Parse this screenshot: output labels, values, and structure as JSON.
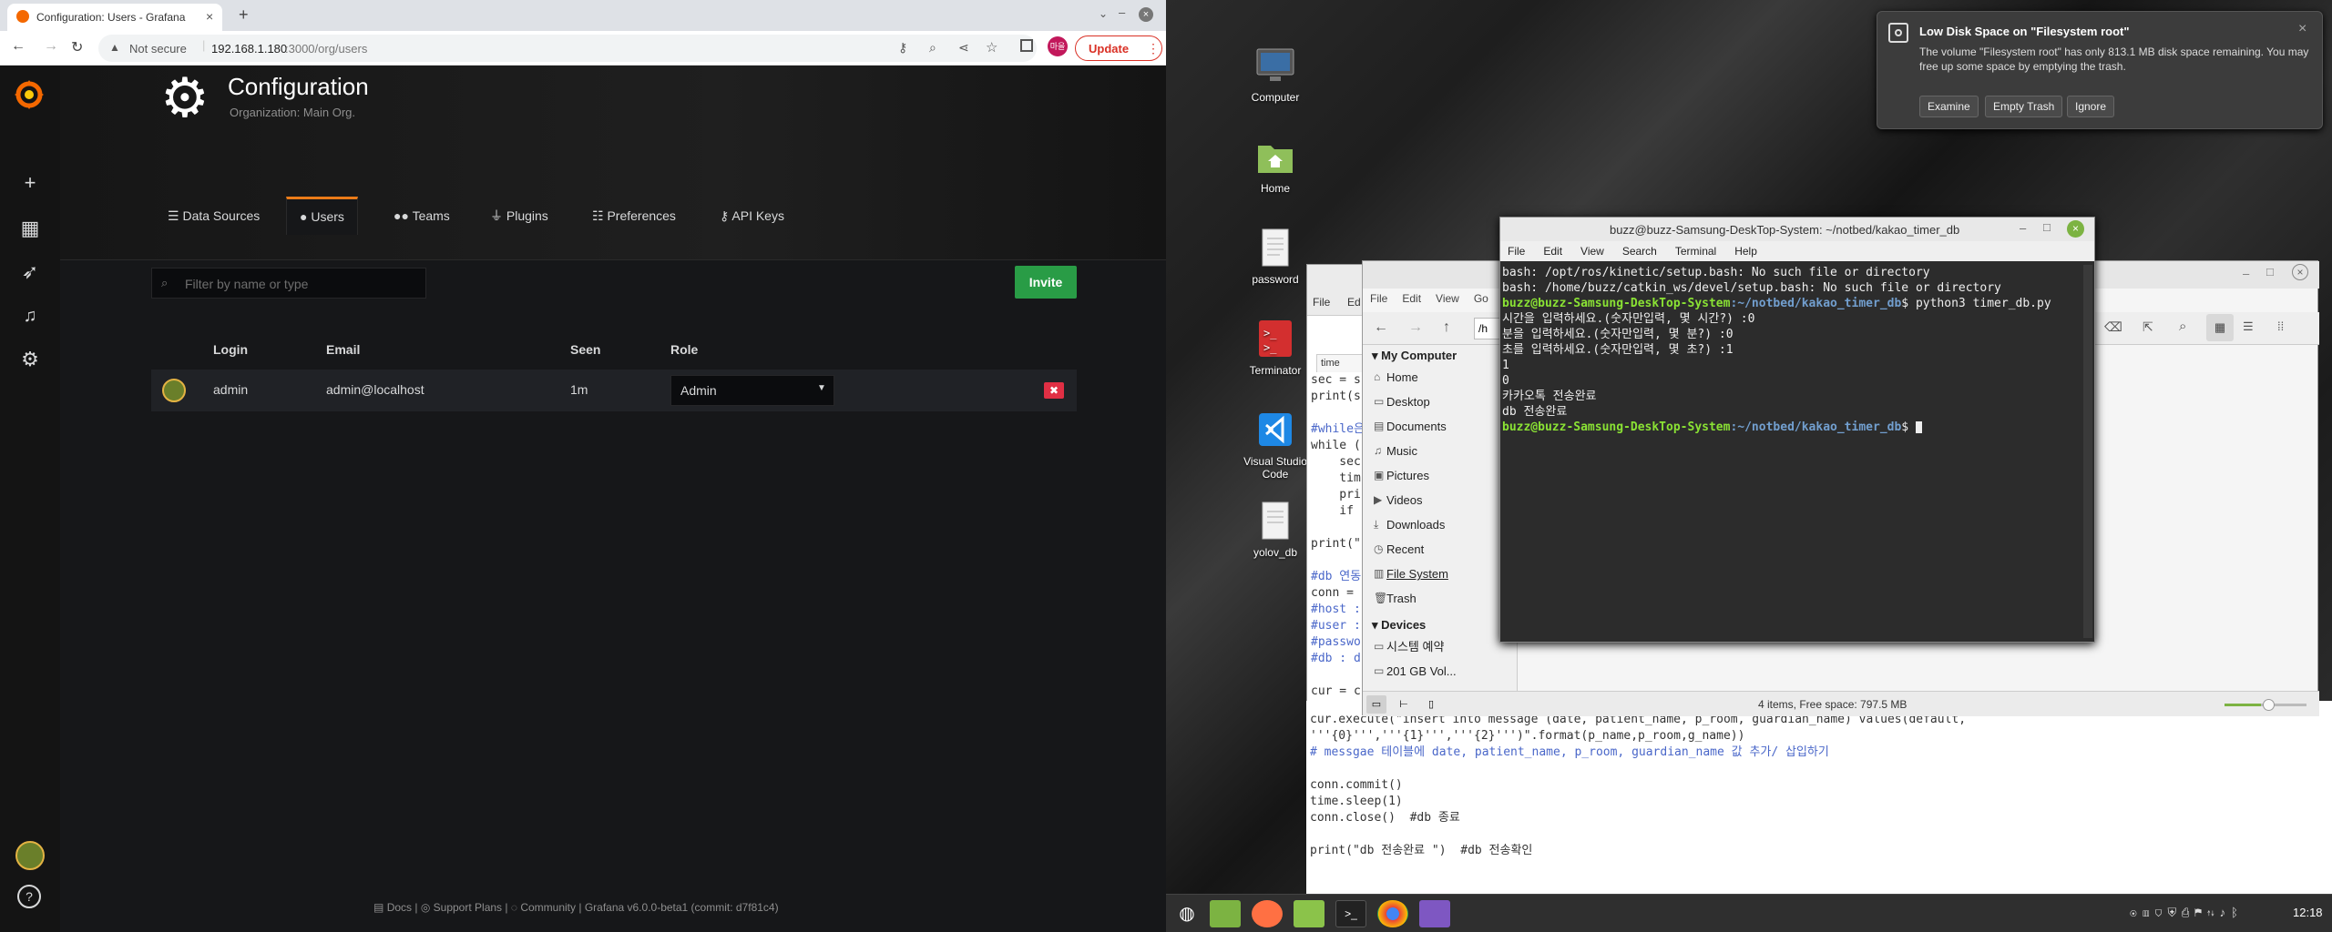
{
  "browser": {
    "tab_title": "Configuration: Users - Grafana",
    "new_tab": "+",
    "not_secure": "Not secure",
    "url_host": "192.168.1.180",
    "url_path": ":3000/org/users",
    "update_label": "Update",
    "profile_text": "마을"
  },
  "grafana": {
    "page_title": "Configuration",
    "page_subtitle": "Organization: Main Org.",
    "tabs": [
      {
        "label": "Data Sources",
        "icon": "database-icon"
      },
      {
        "label": "Users",
        "icon": "user-icon"
      },
      {
        "label": "Teams",
        "icon": "users-icon"
      },
      {
        "label": "Plugins",
        "icon": "plug-icon"
      },
      {
        "label": "Preferences",
        "icon": "sliders-icon"
      },
      {
        "label": "API Keys",
        "icon": "key-icon"
      }
    ],
    "filter_placeholder": "Filter by name or type",
    "invite_label": "Invite",
    "table": {
      "headers": [
        "Login",
        "Email",
        "Seen",
        "Role"
      ],
      "rows": [
        {
          "login": "admin",
          "email": "admin@localhost",
          "seen": "1m",
          "role": "Admin"
        }
      ]
    },
    "footer": {
      "docs": "Docs",
      "support": "Support Plans",
      "community": "Community",
      "version": "Grafana v6.0.0-beta1 (commit: d7f81c4)"
    }
  },
  "desktop": {
    "icons": [
      "Computer",
      "Home",
      "password",
      "Terminator",
      "Visual Studio Code",
      "yolov_db"
    ]
  },
  "notification": {
    "title": "Low Disk Space on \"Filesystem root\"",
    "body": "The volume \"Filesystem root\" has only 813.1 MB disk space remaining.  You may free up some space by emptying the trash.",
    "buttons": [
      "Examine",
      "Empty Trash",
      "Ignore"
    ]
  },
  "terminal": {
    "title": "buzz@buzz-Samsung-DeskTop-System: ~/notbed/kakao_timer_db",
    "menu": [
      "File",
      "Edit",
      "View",
      "Search",
      "Terminal",
      "Help"
    ],
    "lines": [
      {
        "text": "bash: /opt/ros/kinetic/setup.bash: No such file or directory",
        "kind": "plain"
      },
      {
        "text": "bash: /home/buzz/catkin_ws/devel/setup.bash: No such file or directory",
        "kind": "plain"
      },
      {
        "prompt_user": "buzz@buzz-Samsung-DeskTop-System",
        "prompt_path": ":~/notbed/kakao_timer_db",
        "cmd": "$ python3 timer_db.py",
        "kind": "prompt"
      },
      {
        "text": "시간을 입력하세요.(숫자만입력, 몇 시간?) :0",
        "kind": "plain"
      },
      {
        "text": "분을 입력하세요.(숫자만입력, 몇 분?) :0",
        "kind": "plain"
      },
      {
        "text": "초를 입력하세요.(숫자만입력, 몇 초?) :1",
        "kind": "plain"
      },
      {
        "text": "1",
        "kind": "plain"
      },
      {
        "text": "0",
        "kind": "plain"
      },
      {
        "text": "카카오톡 전송완료",
        "kind": "plain"
      },
      {
        "text": "db 전송완료",
        "kind": "plain"
      },
      {
        "prompt_user": "buzz@buzz-Samsung-DeskTop-System",
        "prompt_path": ":~/notbed/kakao_timer_db",
        "cmd": "$ ",
        "kind": "prompt"
      }
    ]
  },
  "file_manager": {
    "menu": [
      "File",
      "Edit",
      "View",
      "Go"
    ],
    "path_fragment": "/h",
    "section_my_computer": "My Computer",
    "places": [
      "Home",
      "Desktop",
      "Documents",
      "Music",
      "Pictures",
      "Videos",
      "Downloads",
      "Recent",
      "File System",
      "Trash"
    ],
    "section_devices": "Devices",
    "devices": [
      "시스템 예약",
      "201 GB Vol..."
    ],
    "status": "4 items, Free space: 797.5 MB"
  },
  "editor": {
    "menu_fragment": "File",
    "menu_fragment2": "Ed",
    "tab_fragment": "time",
    "code_top": [
      {
        "text": "sec = s",
        "color": "#333"
      },
      {
        "text": "print(s",
        "color": "#333"
      },
      {
        "text": "",
        "color": "#333"
      },
      {
        "text": "#while은",
        "color": "#4a67c9"
      },
      {
        "text": "while (",
        "color": "#333"
      },
      {
        "text": "    sec",
        "color": "#333"
      },
      {
        "text": "    tim",
        "color": "#333"
      },
      {
        "text": "    pri",
        "color": "#333"
      },
      {
        "text": "    if",
        "color": "#333"
      },
      {
        "text": "",
        "color": "#333"
      },
      {
        "text": "print(\"",
        "color": "#333"
      },
      {
        "text": "",
        "color": "#333"
      },
      {
        "text": "#db 연동",
        "color": "#4a67c9"
      },
      {
        "text": "conn =",
        "color": "#333"
      },
      {
        "text": "#host :",
        "color": "#4a67c9"
      },
      {
        "text": "#user :",
        "color": "#4a67c9"
      },
      {
        "text": "#passwo",
        "color": "#4a67c9"
      },
      {
        "text": "#db : d",
        "color": "#4a67c9"
      },
      {
        "text": "",
        "color": "#333"
      },
      {
        "text": "cur = c",
        "color": "#333"
      }
    ],
    "code_bottom": [
      {
        "text": "cur.execute(\"insert into message (date, patient_name, p_room, guardian_name) values(default,",
        "color": "#333"
      },
      {
        "text": "'''{0}''','''{1}''','''{2}''')\".format(p_name,p_room,g_name))",
        "color": "#333"
      },
      {
        "text": "# messgae 테이블에 date, patient_name, p_room, guardian_name 값 추가/ 삽입하기",
        "color": "#4a67c9"
      },
      {
        "text": "",
        "color": "#333"
      },
      {
        "text": "conn.commit()",
        "color": "#333"
      },
      {
        "text": "time.sleep(1)",
        "color": "#333"
      },
      {
        "text": "conn.close()  #db 종료",
        "color": "#333"
      },
      {
        "text": "",
        "color": "#333"
      },
      {
        "text": "print(\"db 전송완료 \")  #db 전송확인",
        "color": "#333"
      }
    ]
  },
  "panel": {
    "clock": "12:18"
  },
  "colors": {
    "grafana_orange": "#eb7b18",
    "invite_green": "#299c46",
    "delete_red": "#e02f44",
    "terminal_prompt": "#8ae234",
    "terminal_path": "#729fcf"
  }
}
